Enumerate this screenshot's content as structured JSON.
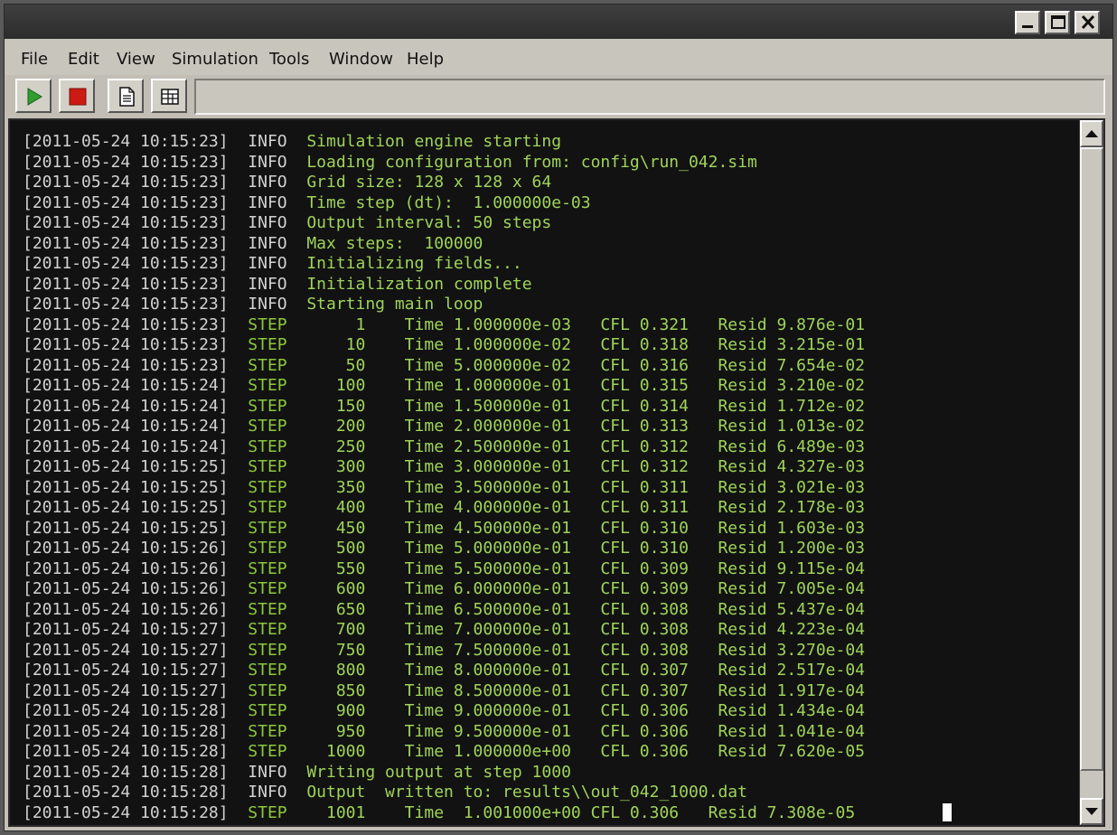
{
  "window": {
    "controls": [
      "minimize-icon",
      "maximize-icon",
      "close-icon"
    ]
  },
  "menu": [
    "File",
    "Edit",
    "View",
    "Simulation",
    "Tools",
    "Window",
    "Help"
  ],
  "toolbar": {
    "buttons": [
      {
        "name": "run-button",
        "icon": "play-icon",
        "color": "#2f9e2f"
      },
      {
        "name": "stop-button",
        "icon": "stop-icon",
        "color": "#cc1b12"
      },
      {
        "name": "document-button",
        "icon": "document-icon"
      },
      {
        "name": "grid-button",
        "icon": "table-grid-icon"
      }
    ]
  },
  "colors": {
    "timestamp": "#d2d2d2",
    "info_level": "#d2d2d2",
    "step_level": "#8cc83c",
    "message": "#9fd45a",
    "console_bg": "#121212"
  },
  "log": [
    {
      "ts": "[2011-05-24 10:15:23]",
      "level": "INFO",
      "msg": "Simulation engine starting"
    },
    {
      "ts": "[2011-05-24 10:15:23]",
      "level": "INFO",
      "msg": "Loading configuration from: config\\run_042.sim"
    },
    {
      "ts": "[2011-05-24 10:15:23]",
      "level": "INFO",
      "msg": "Grid size: 128 x 128 x 64"
    },
    {
      "ts": "[2011-05-24 10:15:23]",
      "level": "INFO",
      "msg": "Time step (dt):  1.000000e-03"
    },
    {
      "ts": "[2011-05-24 10:15:23]",
      "level": "INFO",
      "msg": "Output interval: 50 steps"
    },
    {
      "ts": "[2011-05-24 10:15:23]",
      "level": "INFO",
      "msg": "Max steps:  100000"
    },
    {
      "ts": "[2011-05-24 10:15:23]",
      "level": "INFO",
      "msg": "Initializing fields..."
    },
    {
      "ts": "[2011-05-24 10:15:23]",
      "level": "INFO",
      "msg": "Initialization complete"
    },
    {
      "ts": "[2011-05-24 10:15:23]",
      "level": "INFO",
      "msg": "Starting main loop"
    },
    {
      "ts": "[2011-05-24 10:15:23]",
      "level": "STEP",
      "msg": "     1    Time 1.000000e-03   CFL 0.321   Resid 9.876e-01"
    },
    {
      "ts": "[2011-05-24 10:15:23]",
      "level": "STEP",
      "msg": "    10    Time 1.000000e-02   CFL 0.318   Resid 3.215e-01"
    },
    {
      "ts": "[2011-05-24 10:15:23]",
      "level": "STEP",
      "msg": "    50    Time 5.000000e-02   CFL 0.316   Resid 7.654e-02"
    },
    {
      "ts": "[2011-05-24 10:15:24]",
      "level": "STEP",
      "msg": "   100    Time 1.000000e-01   CFL 0.315   Resid 3.210e-02"
    },
    {
      "ts": "[2011-05-24 10:15:24]",
      "level": "STEP",
      "msg": "   150    Time 1.500000e-01   CFL 0.314   Resid 1.712e-02"
    },
    {
      "ts": "[2011-05-24 10:15:24]",
      "level": "STEP",
      "msg": "   200    Time 2.000000e-01   CFL 0.313   Resid 1.013e-02"
    },
    {
      "ts": "[2011-05-24 10:15:24]",
      "level": "STEP",
      "msg": "   250    Time 2.500000e-01   CFL 0.312   Resid 6.489e-03"
    },
    {
      "ts": "[2011-05-24 10:15:25]",
      "level": "STEP",
      "msg": "   300    Time 3.000000e-01   CFL 0.312   Resid 4.327e-03"
    },
    {
      "ts": "[2011-05-24 10:15:25]",
      "level": "STEP",
      "msg": "   350    Time 3.500000e-01   CFL 0.311   Resid 3.021e-03"
    },
    {
      "ts": "[2011-05-24 10:15:25]",
      "level": "STEP",
      "msg": "   400    Time 4.000000e-01   CFL 0.311   Resid 2.178e-03"
    },
    {
      "ts": "[2011-05-24 10:15:25]",
      "level": "STEP",
      "msg": "   450    Time 4.500000e-01   CFL 0.310   Resid 1.603e-03"
    },
    {
      "ts": "[2011-05-24 10:15:26]",
      "level": "STEP",
      "msg": "   500    Time 5.000000e-01   CFL 0.310   Resid 1.200e-03"
    },
    {
      "ts": "[2011-05-24 10:15:26]",
      "level": "STEP",
      "msg": "   550    Time 5.500000e-01   CFL 0.309   Resid 9.115e-04"
    },
    {
      "ts": "[2011-05-24 10:15:26]",
      "level": "STEP",
      "msg": "   600    Time 6.000000e-01   CFL 0.309   Resid 7.005e-04"
    },
    {
      "ts": "[2011-05-24 10:15:26]",
      "level": "STEP",
      "msg": "   650    Time 6.500000e-01   CFL 0.308   Resid 5.437e-04"
    },
    {
      "ts": "[2011-05-24 10:15:27]",
      "level": "STEP",
      "msg": "   700    Time 7.000000e-01   CFL 0.308   Resid 4.223e-04"
    },
    {
      "ts": "[2011-05-24 10:15:27]",
      "level": "STEP",
      "msg": "   750    Time 7.500000e-01   CFL 0.308   Resid 3.270e-04"
    },
    {
      "ts": "[2011-05-24 10:15:27]",
      "level": "STEP",
      "msg": "   800    Time 8.000000e-01   CFL 0.307   Resid 2.517e-04"
    },
    {
      "ts": "[2011-05-24 10:15:27]",
      "level": "STEP",
      "msg": "   850    Time 8.500000e-01   CFL 0.307   Resid 1.917e-04"
    },
    {
      "ts": "[2011-05-24 10:15:28]",
      "level": "STEP",
      "msg": "   900    Time 9.000000e-01   CFL 0.306   Resid 1.434e-04"
    },
    {
      "ts": "[2011-05-24 10:15:28]",
      "level": "STEP",
      "msg": "   950    Time 9.500000e-01   CFL 0.306   Resid 1.041e-04"
    },
    {
      "ts": "[2011-05-24 10:15:28]",
      "level": "STEP",
      "msg": "  1000    Time 1.000000e+00   CFL 0.306   Resid 7.620e-05"
    },
    {
      "ts": "[2011-05-24 10:15:28]",
      "level": "INFO",
      "msg": "Writing output at step 1000"
    },
    {
      "ts": "[2011-05-24 10:15:28]",
      "level": "INFO",
      "msg": "Output  written to: results\\\\out_042_1000.dat"
    },
    {
      "ts": "[2011-05-24 10:15:28]",
      "level": "STEP",
      "msg": "  1001    Time  1.001000e+00 CFL 0.306   Resid 7.308e-05"
    }
  ]
}
